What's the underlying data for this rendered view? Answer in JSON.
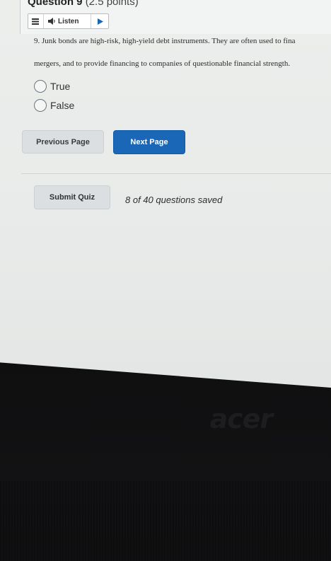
{
  "question": {
    "title": "Question 9",
    "points": "(2.5 points)",
    "toolbar": {
      "listen_label": "Listen"
    },
    "text_line1": "9. Junk bonds are high-risk, high-yield debt instruments. They are often used to fina",
    "text_line2": "mergers, and to provide financing to companies of questionable financial strength.",
    "choices": [
      {
        "label": "True",
        "selected": false
      },
      {
        "label": "False",
        "selected": false
      }
    ]
  },
  "navigation": {
    "previous_label": "Previous Page",
    "next_label": "Next Page"
  },
  "submit": {
    "submit_label": "Submit Quiz",
    "saved_status": "8 of 40 questions saved"
  },
  "laptop": {
    "logo_text": "acer"
  },
  "colors": {
    "primary_button": "#1a67b8",
    "secondary_button": "#dcdfe1",
    "screen_background": "#eceeec",
    "bezel": "#0f0f10"
  },
  "icons": [
    "menu-icon",
    "speaker-icon",
    "play-icon"
  ]
}
